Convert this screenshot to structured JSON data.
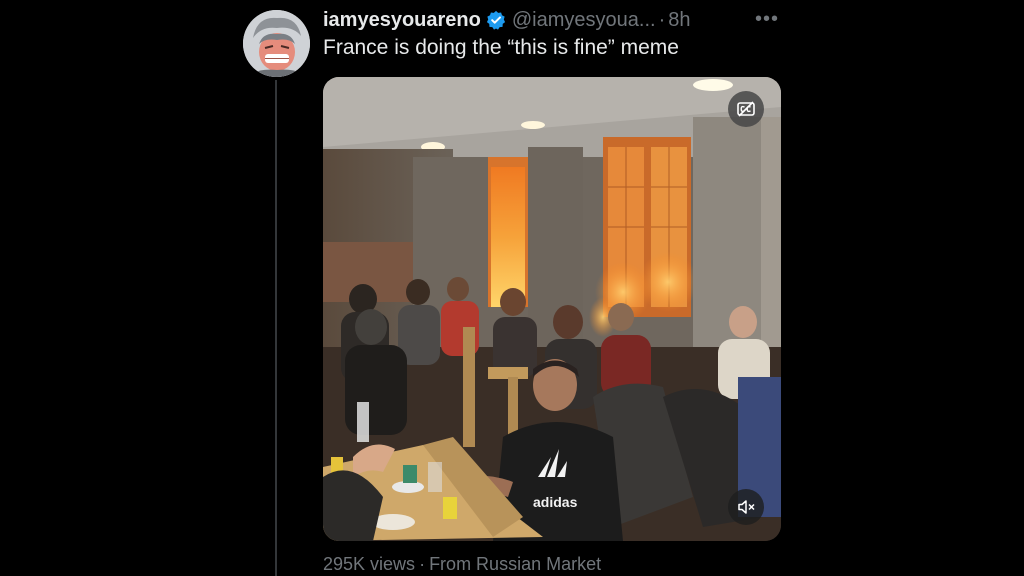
{
  "tweet": {
    "display_name": "iamyesyouareno",
    "handle": "@iamyesyoua...",
    "separator": "·",
    "time": "8h",
    "more_label": "•••",
    "text": "France is doing the “this is fine” meme",
    "verified": true
  },
  "media": {
    "type": "video",
    "scene": "restaurant-fire-video",
    "shirt_logo": "adidas",
    "caption_icon": "closed-captions-icon",
    "mute_icon": "speaker-muted-icon"
  },
  "footer": {
    "views": "295K views",
    "separator": "·",
    "source": "From Russian Market"
  },
  "colors": {
    "background": "#000000",
    "text_primary": "#e7e9ea",
    "text_secondary": "#71767b",
    "verified_blue": "#1d9bf0",
    "thread_line": "#333639"
  }
}
